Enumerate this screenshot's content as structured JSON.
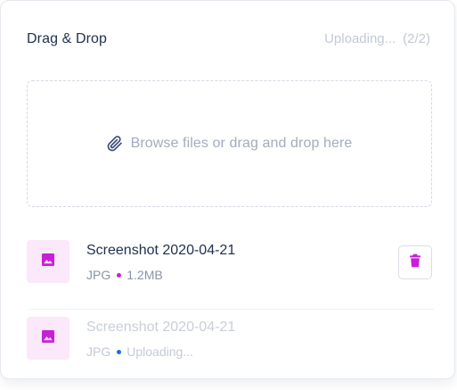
{
  "header": {
    "title": "Drag & Drop",
    "status_label": "Uploading...",
    "status_count": "(2/2)"
  },
  "dropzone": {
    "icon": "paperclip-icon",
    "prompt": "Browse files or drag and drop here"
  },
  "files": [
    {
      "name": "Screenshot 2020-04-21",
      "type": "JPG",
      "detail": "1.2MB",
      "dot_color": "#c81ed7",
      "icon": "image-icon",
      "action_icon": "trash-icon"
    },
    {
      "name": "Screenshot 2020-04-21",
      "type": "JPG",
      "detail": "Uploading...",
      "dot_color": "#1a6cf0",
      "icon": "image-icon"
    }
  ],
  "colors": {
    "accent": "#c81ed7",
    "thumb_bg": "#fbe8fb",
    "uploading_dot": "#1a6cf0",
    "title": "#1f2f4d"
  }
}
